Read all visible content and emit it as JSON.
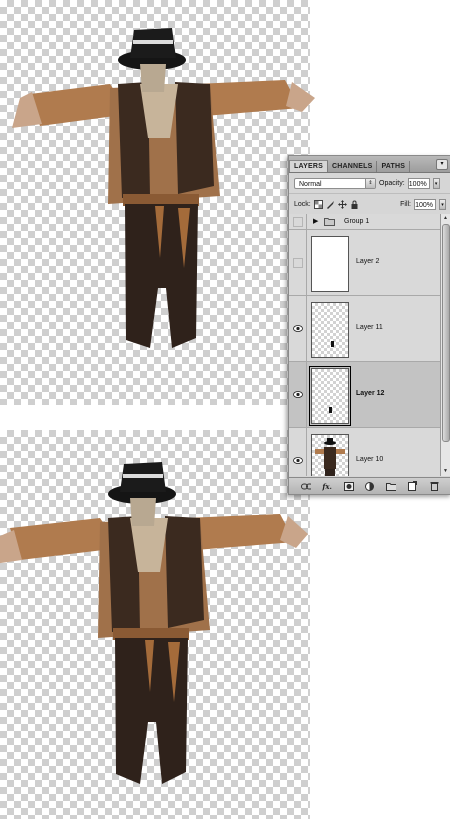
{
  "layers_panel": {
    "tabs": [
      {
        "label": "LAYERS",
        "active": true
      },
      {
        "label": "CHANNELS",
        "active": false
      },
      {
        "label": "PATHS",
        "active": false
      }
    ],
    "menu_icon": "panel-menu-icon",
    "blend_mode": "Normal",
    "opacity_label": "Opacity:",
    "opacity_value": "100%",
    "lock_label": "Lock:",
    "fill_label": "Fill:",
    "fill_value": "100%",
    "layers": [
      {
        "name": "Group 1",
        "type": "group",
        "visible": false,
        "selected": false
      },
      {
        "name": "Layer 2",
        "type": "white",
        "visible": false,
        "selected": false
      },
      {
        "name": "Layer 11",
        "type": "transparent-mark",
        "visible": true,
        "selected": false
      },
      {
        "name": "Layer 12",
        "type": "transparent-mark",
        "visible": true,
        "selected": true
      },
      {
        "name": "Layer 10",
        "type": "scarecrow",
        "visible": true,
        "selected": false
      }
    ],
    "bottom_icons": [
      "link-layers-icon",
      "fx-icon",
      "layer-mask-icon",
      "adjustment-layer-icon",
      "new-group-icon",
      "new-layer-icon",
      "trash-icon"
    ],
    "fx_label": "fx."
  },
  "colors": {
    "panel_bg": "#d6d6d6",
    "selected_row": "#c3c3c3",
    "sleeve": "#b07b4e",
    "vest": "#3b2a1f",
    "pants": "#2f221b"
  }
}
